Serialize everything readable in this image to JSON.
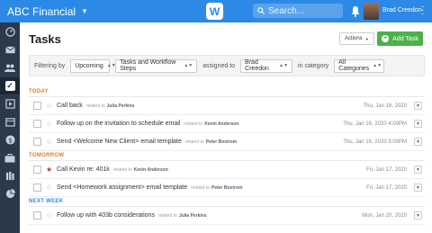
{
  "topbar": {
    "company": "ABC Financial",
    "logo_letter": "W",
    "search_placeholder": "Search...",
    "username": "Brad Creedon"
  },
  "sidebar": {
    "items": [
      {
        "icon": "dashboard-icon"
      },
      {
        "icon": "mail-icon"
      },
      {
        "icon": "contacts-icon"
      },
      {
        "icon": "tasks-icon",
        "active": true
      },
      {
        "icon": "video-icon"
      },
      {
        "icon": "calendar-icon"
      },
      {
        "icon": "dollar-icon"
      },
      {
        "icon": "briefcase-icon"
      },
      {
        "icon": "library-icon"
      },
      {
        "icon": "reports-icon"
      }
    ]
  },
  "page": {
    "title": "Tasks",
    "actions_label": "Actions",
    "add_task_label": "Add Task"
  },
  "filters": {
    "filtering_by_label": "Filtering by",
    "timeframe": "Upcoming",
    "type": "Tasks and Workflow Steps",
    "assigned_to_label": "assigned to",
    "assignee": "Brad Creedon",
    "in_category_label": "in category",
    "category": "All Categories"
  },
  "sections": {
    "today": "TODAY",
    "tomorrow": "TOMORROW",
    "next_week": "NEXT WEEK"
  },
  "tasks": [
    {
      "title": "Call back",
      "related_label": "related to",
      "who": "Julia Perkins",
      "date": "Thu, Jan 16, 2020",
      "starred": false
    },
    {
      "title": "Follow up on the invitation to schedule email",
      "related_label": "related to",
      "who": "Kevin Anderson",
      "date": "Thu, Jan 16, 2020 4:00PM",
      "starred": false
    },
    {
      "title": "Send <Welcome New Client> email template",
      "related_label": "related to",
      "who": "Peter Bostrom",
      "date": "Thu, Jan 16, 2020 5:00PM",
      "starred": false
    },
    {
      "title": "Call Kevin re: 401k",
      "related_label": "related to",
      "who": "Kevin Anderson",
      "date": "Fri, Jan 17, 2020",
      "starred": true
    },
    {
      "title": "Send <Homework assignment> email template",
      "related_label": "related to",
      "who": "Peter Bostrom",
      "date": "Fri, Jan 17, 2020",
      "starred": false
    },
    {
      "title": "Follow up with 403b considerations",
      "related_label": "related to",
      "who": "Julia Perkins",
      "date": "Mon, Jan 20, 2020",
      "starred": false
    }
  ],
  "colors": {
    "topbar": "#2c8ae6",
    "sidebar": "#2b3a4a",
    "add_button": "#4db14a",
    "section_orange": "#d9822b",
    "section_blue": "#2c8ae6",
    "star_active": "#c0392b"
  }
}
